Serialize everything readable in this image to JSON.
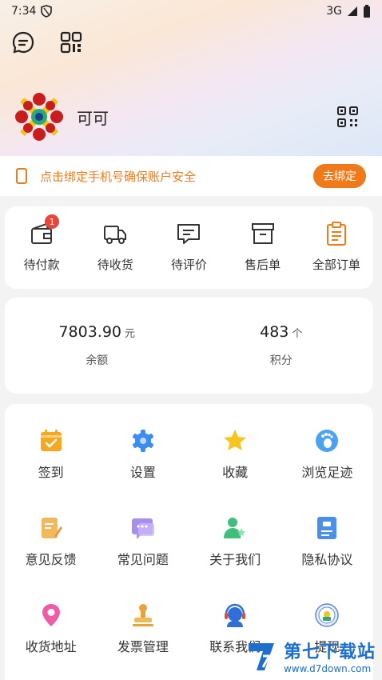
{
  "status_bar": {
    "time": "7:34",
    "network": "3G"
  },
  "profile": {
    "nickname": "可可"
  },
  "bind_phone": {
    "message": "点击绑定手机号确保账户安全",
    "button": "去绑定"
  },
  "orders": [
    {
      "label": "待付款",
      "icon": "wallet-icon",
      "badge": "1"
    },
    {
      "label": "待收货",
      "icon": "truck-icon"
    },
    {
      "label": "待评价",
      "icon": "comment-icon"
    },
    {
      "label": "售后单",
      "icon": "archive-icon"
    },
    {
      "label": "全部订单",
      "icon": "clipboard-icon"
    }
  ],
  "balance": {
    "amount": "7803.90",
    "amount_unit": "元",
    "amount_label": "余额",
    "points": "483",
    "points_unit": "个",
    "points_label": "积分"
  },
  "tools": [
    {
      "label": "签到",
      "icon": "checkin-icon",
      "color": "#f7a823"
    },
    {
      "label": "设置",
      "icon": "settings-icon",
      "color": "#3b8ef0"
    },
    {
      "label": "收藏",
      "icon": "star-icon",
      "color": "#f7c51e"
    },
    {
      "label": "浏览足迹",
      "icon": "footprint-icon",
      "color": "#4aa3f0"
    },
    {
      "label": "意见反馈",
      "icon": "feedback-icon",
      "color": "#f2b85c"
    },
    {
      "label": "常见问题",
      "icon": "faq-icon",
      "color": "#a88ef0"
    },
    {
      "label": "关于我们",
      "icon": "about-icon",
      "color": "#3fbf7a"
    },
    {
      "label": "隐私协议",
      "icon": "privacy-icon",
      "color": "#4a90e8"
    },
    {
      "label": "收货地址",
      "icon": "location-icon",
      "color": "#f05aa8"
    },
    {
      "label": "发票管理",
      "icon": "invoice-icon",
      "color": "#e8a23a"
    },
    {
      "label": "联系我们",
      "icon": "contact-icon",
      "color": "#2f6fd8"
    },
    {
      "label": "提现",
      "icon": "withdraw-icon",
      "color": "#5a8ad8"
    }
  ],
  "watermark": {
    "title": "第七下载站",
    "url": "www.d7down.com"
  },
  "colors": {
    "accent": "#f07a1a",
    "badge": "#e8453c"
  }
}
